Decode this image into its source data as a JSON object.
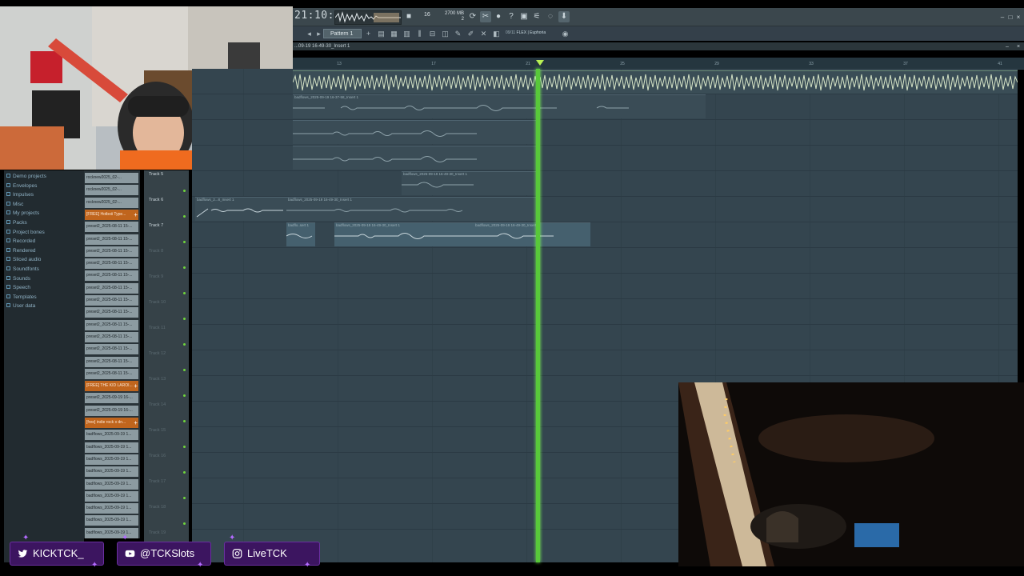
{
  "transport": {
    "clock": "21:10:14",
    "tempo": "16",
    "memory": "2700 MB",
    "memory_sub": "2",
    "icons": [
      "metronome-icon",
      "cut-icon",
      "record-icon",
      "help-icon",
      "save-icon",
      "mixer-icon",
      "chat-icon",
      "download-icon"
    ]
  },
  "toolbar": {
    "pattern_label": "Pattern 1",
    "hint_prefix": "09/11",
    "hint_text": "FLEX | Euphoria"
  },
  "playlist": {
    "title": "...09-19 16-49-30_Insert 1",
    "ruler_ticks": [
      "13",
      "17",
      "21",
      "25",
      "29",
      "33",
      "37",
      "41"
    ]
  },
  "browser": {
    "items": [
      "Demo projects",
      "Envelopes",
      "Impulses",
      "Misc",
      "My projects",
      "Packs",
      "Project bones",
      "Recorded",
      "Rendered",
      "Sliced audio",
      "Soundfonts",
      "Sounds",
      "Speech",
      "Templates",
      "User data"
    ]
  },
  "files": [
    {
      "label": "rocknew2025_02-...",
      "kind": "normal"
    },
    {
      "label": "rocknew2025_02-...",
      "kind": "normal"
    },
    {
      "label": "rocknew2025_02-...",
      "kind": "normal"
    },
    {
      "label": "[FREE] Hotboii Type...",
      "kind": "orange"
    },
    {
      "label": "preset2_2025-08-11 15-...",
      "kind": "normal"
    },
    {
      "label": "preset2_2025-08-11 15-...",
      "kind": "normal"
    },
    {
      "label": "preset2_2025-08-11 15-...",
      "kind": "normal"
    },
    {
      "label": "preset2_2025-08-11 15-...",
      "kind": "normal"
    },
    {
      "label": "preset2_2025-08-11 15-...",
      "kind": "normal"
    },
    {
      "label": "preset2_2025-08-11 15-...",
      "kind": "normal"
    },
    {
      "label": "preset2_2025-08-11 15-...",
      "kind": "normal"
    },
    {
      "label": "preset2_2025-08-11 15-...",
      "kind": "normal"
    },
    {
      "label": "preset2_2025-08-11 15-...",
      "kind": "normal"
    },
    {
      "label": "preset2_2025-08-11 15-...",
      "kind": "normal"
    },
    {
      "label": "preset2_2025-08-11 15-...",
      "kind": "normal"
    },
    {
      "label": "preset2_2025-08-11 15-...",
      "kind": "normal"
    },
    {
      "label": "preset2_2025-08-11 15-...",
      "kind": "normal"
    },
    {
      "label": "[FREE] THE KID LAROI...",
      "kind": "orange"
    },
    {
      "label": "preset2_2025-09-19 16-...",
      "kind": "normal"
    },
    {
      "label": "preset2_2025-09-19 16-...",
      "kind": "normal"
    },
    {
      "label": "[free] indie rock x dn...",
      "kind": "orange"
    },
    {
      "label": "badflows_2025-09-19 1...",
      "kind": "normal"
    },
    {
      "label": "badflows_2025-09-19 1...",
      "kind": "normal"
    },
    {
      "label": "badflows_2025-09-19 1...",
      "kind": "normal"
    },
    {
      "label": "badflows_2025-09-19 1...",
      "kind": "normal"
    },
    {
      "label": "badflows_2025-09-19 1...",
      "kind": "normal"
    },
    {
      "label": "badflows_2025-09-19 1...",
      "kind": "normal"
    },
    {
      "label": "badflows_2025-09-19 1...",
      "kind": "normal"
    },
    {
      "label": "badflows_2025-09-19 1...",
      "kind": "normal"
    },
    {
      "label": "badflows_2025-09-19 1...",
      "kind": "normal"
    }
  ],
  "tracks": [
    {
      "name": "Track 5",
      "active": true
    },
    {
      "name": "Track 6",
      "active": true
    },
    {
      "name": "Track 7",
      "active": true
    },
    {
      "name": "Track 8",
      "active": false
    },
    {
      "name": "Track 9",
      "active": false
    },
    {
      "name": "Track 10",
      "active": false
    },
    {
      "name": "Track 11",
      "active": false
    },
    {
      "name": "Track 12",
      "active": false
    },
    {
      "name": "Track 13",
      "active": false
    },
    {
      "name": "Track 14",
      "active": false
    },
    {
      "name": "Track 15",
      "active": false
    },
    {
      "name": "Track 16",
      "active": false
    },
    {
      "name": "Track 17",
      "active": false
    },
    {
      "name": "Track 18",
      "active": false
    },
    {
      "name": "Track 19",
      "active": false
    }
  ],
  "clips": {
    "row1_a": "badflows_2025-09-19 16-37-58_Insert 1",
    "row1_b": "badflows_2025-09-19 16-49-30_Insert 1",
    "row6_a": "badflows_2...8_Insert 1",
    "row6_b": "badflows_2...8_Insert 1",
    "row6_c": "badflows_2025-09-19 16-49-30_Insert 1",
    "row7_a": "badflo..sert 1",
    "row7_b": "badflows_2025-09-19 16-49-30_Insert 1",
    "row7_c": "badflows_2025-09-19 16-49-30_Insert 1",
    "row5": "badflows_2025-09-19 16-49-30_Insert 1"
  },
  "socials": {
    "twitter": "KICKTCK_",
    "youtube": "@TCKSlots",
    "instagram": "LiveTCK"
  }
}
